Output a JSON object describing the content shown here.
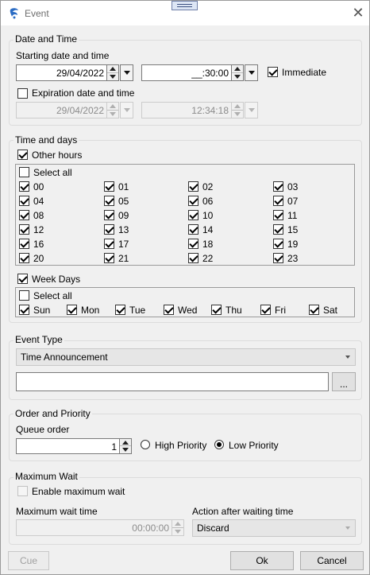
{
  "window": {
    "title": "Event",
    "icon": "app-logo-icon"
  },
  "date_time": {
    "legend": "Date and Time",
    "starting_label": "Starting date and time",
    "start_date": "29/04/2022",
    "start_time": "__:30:00",
    "immediate_label": "Immediate",
    "immediate_checked": true,
    "expiration_label": "Expiration date and time",
    "expiration_checked": false,
    "exp_date": "29/04/2022",
    "exp_time": "12:34:18"
  },
  "time_days": {
    "legend": "Time and days",
    "other_hours_label": "Other hours",
    "other_hours_checked": true,
    "hours_select_all_label": "Select all",
    "hours": [
      "00",
      "01",
      "02",
      "03",
      "04",
      "05",
      "06",
      "07",
      "08",
      "09",
      "10",
      "11",
      "12",
      "13",
      "14",
      "15",
      "16",
      "17",
      "18",
      "19",
      "20",
      "21",
      "22",
      "23"
    ],
    "week_days_label": "Week Days",
    "week_days_checked": true,
    "days_select_all_label": "Select all",
    "days": [
      "Sun",
      "Mon",
      "Tue",
      "Wed",
      "Thu",
      "Fri",
      "Sat"
    ]
  },
  "event_type": {
    "legend": "Event Type",
    "selected": "Time Announcement",
    "browse_label": "..."
  },
  "order": {
    "legend": "Order and Priority",
    "queue_label": "Queue order",
    "queue_value": "1",
    "high_label": "High Priority",
    "low_label": "Low Priority",
    "selected": "low"
  },
  "max_wait": {
    "legend": "Maximum Wait",
    "enable_label": "Enable maximum wait",
    "time_label": "Maximum wait time",
    "time_value": "00:00:00",
    "action_label": "Action after waiting time",
    "action_value": "Discard"
  },
  "buttons": {
    "cue": "Cue",
    "ok": "Ok",
    "cancel": "Cancel"
  }
}
